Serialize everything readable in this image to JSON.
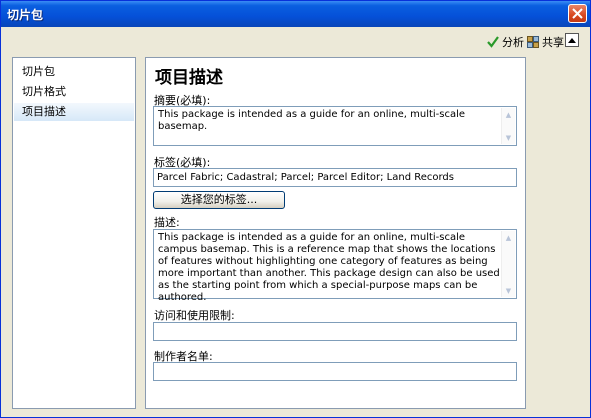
{
  "window": {
    "title": "切片包"
  },
  "toolbar": {
    "analyze_label": "分析",
    "share_label": "共享"
  },
  "nav": {
    "items": [
      {
        "label": "切片包"
      },
      {
        "label": "切片格式"
      },
      {
        "label": "项目描述",
        "selected": true
      }
    ]
  },
  "form": {
    "heading": "项目描述",
    "summary_label": "摘要(必填):",
    "summary_value": "This package is intended as a guide for an online, multi-scale basemap.",
    "tags_label": "标签(必填):",
    "tags_value": "Parcel Fabric; Cadastral; Parcel; Parcel Editor; Land Records",
    "choose_tags_button": "选择您的标签...",
    "description_label": "描述:",
    "description_value": "This package is intended as a guide for an online, multi-scale campus basemap. This is a reference map that shows the locations of features without highlighting one category of features as being more important than another. This package design can also be used as the starting point from which a special-purpose maps can be authored.",
    "access_label": "访问和使用限制:",
    "access_value": "",
    "credits_label": "制作者名单:",
    "credits_value": ""
  },
  "colors": {
    "titlebar": "#0550d8",
    "close": "#d8481f",
    "selection": "#d6e8f8",
    "check": "#2a9a2a"
  }
}
